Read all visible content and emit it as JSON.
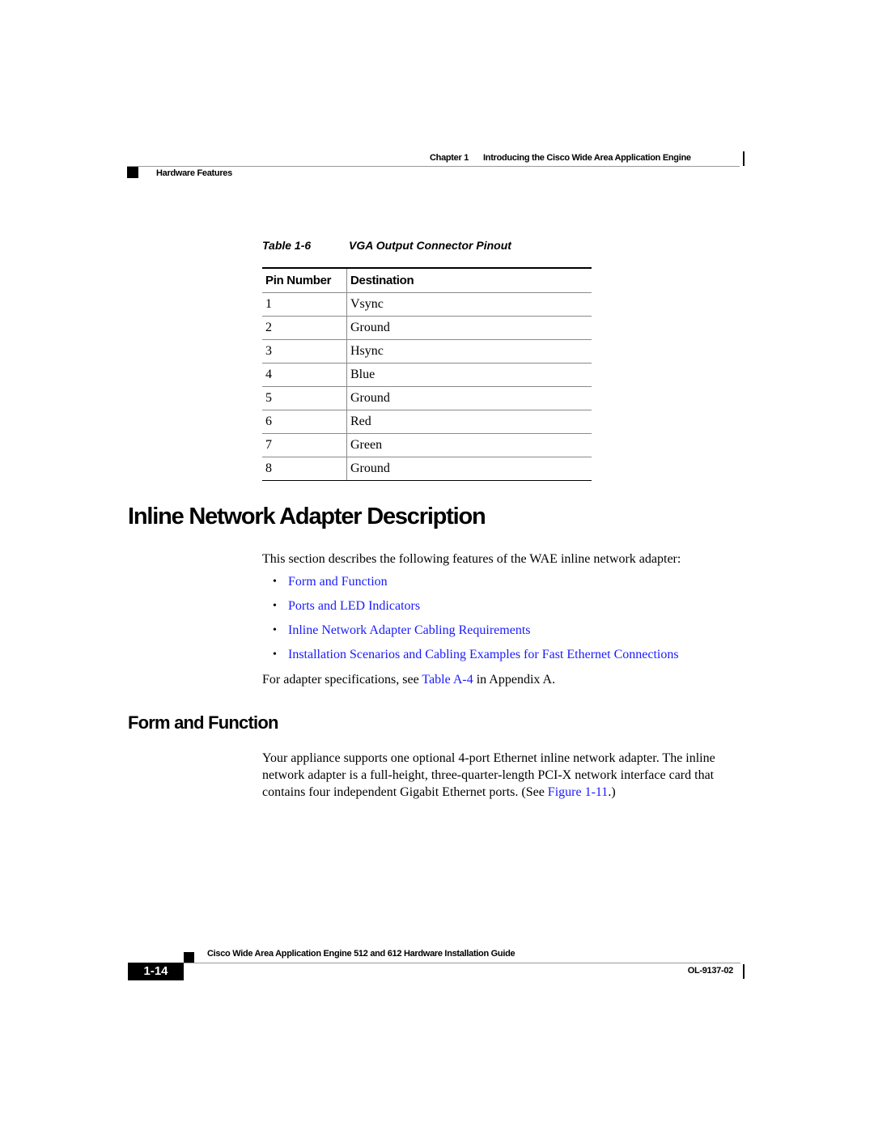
{
  "header": {
    "chapter_label": "Chapter 1",
    "chapter_title": "Introducing the Cisco Wide Area Application Engine",
    "section": "Hardware Features"
  },
  "table": {
    "caption_number": "Table 1-6",
    "caption_title": "VGA Output Connector Pinout",
    "columns": [
      "Pin Number",
      "Destination"
    ],
    "rows": [
      {
        "pin": "1",
        "destination": "Vsync"
      },
      {
        "pin": "2",
        "destination": "Ground"
      },
      {
        "pin": "3",
        "destination": "Hsync"
      },
      {
        "pin": "4",
        "destination": "Blue"
      },
      {
        "pin": "5",
        "destination": "Ground"
      },
      {
        "pin": "6",
        "destination": "Red"
      },
      {
        "pin": "7",
        "destination": "Green"
      },
      {
        "pin": "8",
        "destination": "Ground"
      }
    ]
  },
  "section": {
    "title": "Inline Network Adapter Description",
    "intro": "This section describes the following features of the WAE inline network adapter:",
    "links": [
      "Form and Function",
      "Ports and LED Indicators",
      "Inline Network Adapter Cabling Requirements",
      "Installation Scenarios and Cabling Examples for Fast Ethernet Connections"
    ],
    "spec_prefix": "For adapter specifications, see ",
    "spec_link": "Table A-4",
    "spec_suffix": " in Appendix A."
  },
  "subsection": {
    "title": "Form and Function",
    "body": "Your appliance supports one optional 4-port Ethernet inline network adapter. The inline network adapter is a full-height, three-quarter-length PCI-X network interface card that contains four independent Gigabit Ethernet ports. (See ",
    "figure_link": "Figure 1-11",
    "body_end": ".)"
  },
  "footer": {
    "guide_title": "Cisco Wide Area Application Engine 512 and 612 Hardware Installation Guide",
    "page_number": "1-14",
    "doc_number": "OL-9137-02"
  },
  "colors": {
    "link": "#1a1aff",
    "rule": "#9a9a9a"
  }
}
